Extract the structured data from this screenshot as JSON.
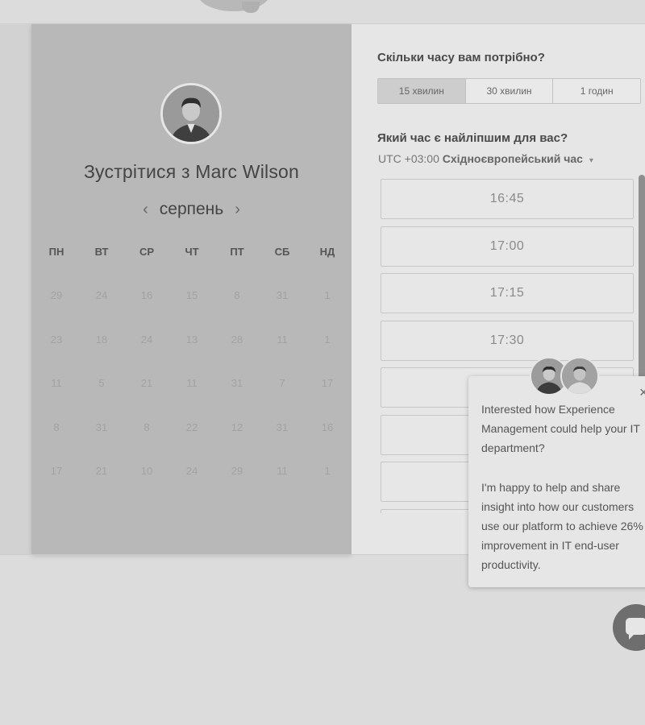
{
  "scheduler": {
    "title": "Зустрітися з Marc Wilson",
    "month": "серпень",
    "prev_icon": "‹",
    "next_icon": "›",
    "weekdays": [
      "ПН",
      "ВТ",
      "СР",
      "ЧТ",
      "ПТ",
      "СБ",
      "НД"
    ],
    "days": [
      [
        "29",
        "24",
        "16",
        "15",
        "8",
        "31",
        "1"
      ],
      [
        "23",
        "18",
        "24",
        "13",
        "28",
        "11",
        "1"
      ],
      [
        "11",
        "5",
        "21",
        "11",
        "31",
        "7",
        "17"
      ],
      [
        "8",
        "31",
        "8",
        "22",
        "12",
        "31",
        "16"
      ],
      [
        "17",
        "21",
        "10",
        "24",
        "29",
        "11",
        "1"
      ]
    ]
  },
  "booking": {
    "duration_question": "Скільки часу вам потрібно?",
    "durations": [
      "15 хвилин",
      "30 хвилин",
      "1 годин"
    ],
    "selected_duration": "15 хвилин",
    "time_question": "Який час є найліпшим для вас?",
    "timezone_prefix": "UTC +03:00",
    "timezone_name": "Східноєвропейський час",
    "timezone_caret": "▾",
    "slots": [
      "16:45",
      "17:00",
      "17:15",
      "17:30",
      "",
      "",
      "",
      ""
    ]
  },
  "chat": {
    "close_icon": "×",
    "message_1": "Interested how Experience Management could help your IT department?",
    "message_2": "I'm happy to help and share insight into how our customers use our platform to achieve 26% improvement in IT end-user productivity."
  },
  "colors": {
    "calendar_panel": "#b8b8b8",
    "right_panel": "#e6e6e6",
    "page_background": "#dcdcdc"
  }
}
